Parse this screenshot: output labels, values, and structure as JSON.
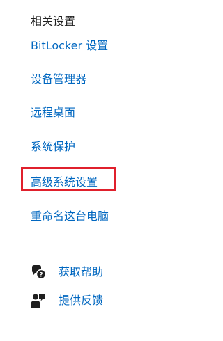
{
  "related_settings": {
    "title": "相关设置",
    "links": [
      {
        "label": "BitLocker 设置"
      },
      {
        "label": "设备管理器"
      },
      {
        "label": "远程桌面"
      },
      {
        "label": "系统保护"
      },
      {
        "label": "高级系统设置"
      },
      {
        "label": "重命名这台电脑"
      }
    ],
    "highlighted_item": "高级系统设置",
    "highlight_color": "#e0202c"
  },
  "help": {
    "items": [
      {
        "label": "获取帮助",
        "icon": "help-chat-icon"
      },
      {
        "label": "提供反馈",
        "icon": "feedback-person-icon"
      }
    ]
  },
  "colors": {
    "link": "#0067c0",
    "text": "#1f1f1f",
    "background": "#ffffff"
  }
}
